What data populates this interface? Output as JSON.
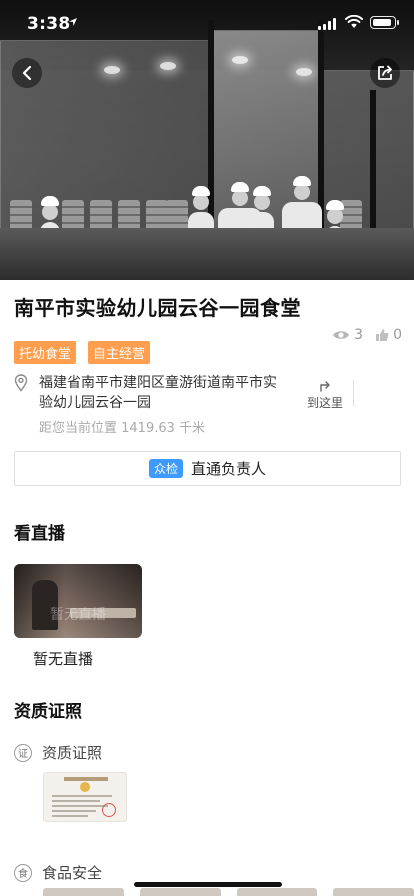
{
  "status_bar": {
    "time": "3:38"
  },
  "header": {
    "title": "南平市实验幼儿园云谷一园食堂"
  },
  "stats": {
    "views": "3",
    "likes": "0"
  },
  "tags": [
    "托幼食堂",
    "自主经营"
  ],
  "address": {
    "text": "福建省南平市建阳区童游街道南平市实验幼儿园云谷一园",
    "distance": "距您当前位置 1419.63 千米",
    "goto_label": "到这里"
  },
  "contact": {
    "badge": "众检",
    "label": "直通负责人"
  },
  "live": {
    "section_title": "看直播",
    "overlay": "暂无直播",
    "caption": "暂无直播"
  },
  "certificates": {
    "section_title": "资质证照",
    "items": [
      {
        "icon_char": "证",
        "label": "资质证照"
      },
      {
        "icon_char": "食",
        "label": "食品安全"
      }
    ]
  },
  "colors": {
    "tag_bg": "#ff9e4f",
    "badge_bg": "#3d9bff"
  }
}
